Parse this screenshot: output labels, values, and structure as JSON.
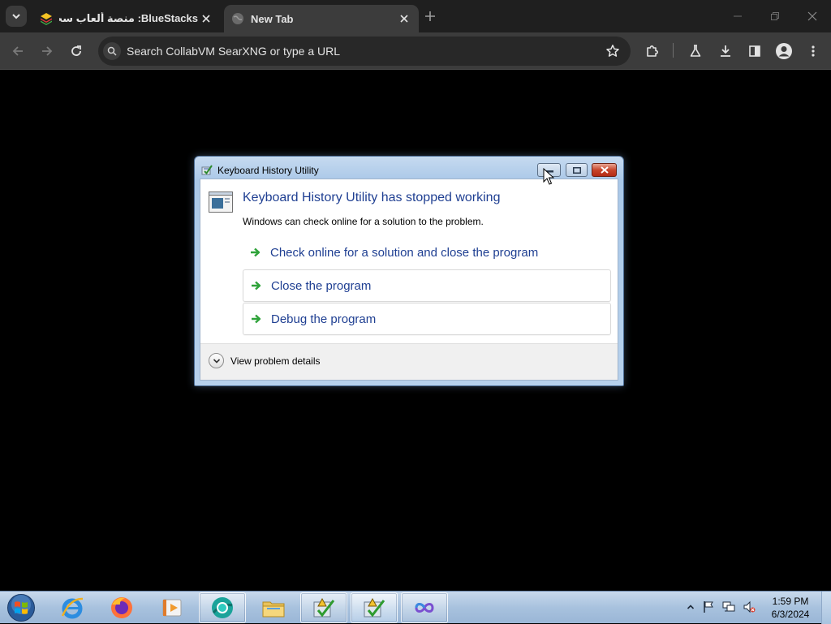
{
  "browser": {
    "tabs": [
      {
        "title": "BlueStacks: منصة ألعاب سحابية ،أندرويد",
        "active": false,
        "favicon": "bluestacks-icon"
      },
      {
        "title": "New Tab",
        "active": true,
        "favicon": "globe-icon"
      }
    ],
    "omnibox": {
      "placeholder": "Search CollabVM SearXNG or type a URL"
    }
  },
  "dialog": {
    "title": "Keyboard History Utility",
    "heading": "Keyboard History Utility has stopped working",
    "message": "Windows can check online for a solution to the problem.",
    "options": [
      {
        "label": "Check online for a solution and close the program"
      },
      {
        "label": "Close the program"
      },
      {
        "label": "Debug the program"
      }
    ],
    "details_toggle": "View problem details"
  },
  "taskbar": {
    "apps": [
      {
        "name": "internet-explorer-icon",
        "running": false
      },
      {
        "name": "firefox-icon",
        "running": false
      },
      {
        "name": "media-player-icon",
        "running": false
      },
      {
        "name": "chromium-icon",
        "running": true
      },
      {
        "name": "file-explorer-icon",
        "running": false
      },
      {
        "name": "error-report-icon",
        "running": true
      },
      {
        "name": "error-report-icon",
        "running": true,
        "active": true
      },
      {
        "name": "infinity-app-icon",
        "running": true
      }
    ],
    "clock": {
      "time": "1:59 PM",
      "date": "6/3/2024"
    }
  },
  "colors": {
    "chrome_dark": "#1f1f1f",
    "chrome_toolbar": "#3c3c3c",
    "dialog_heading": "#1f3f92",
    "taskbar": "#a8c2de"
  }
}
